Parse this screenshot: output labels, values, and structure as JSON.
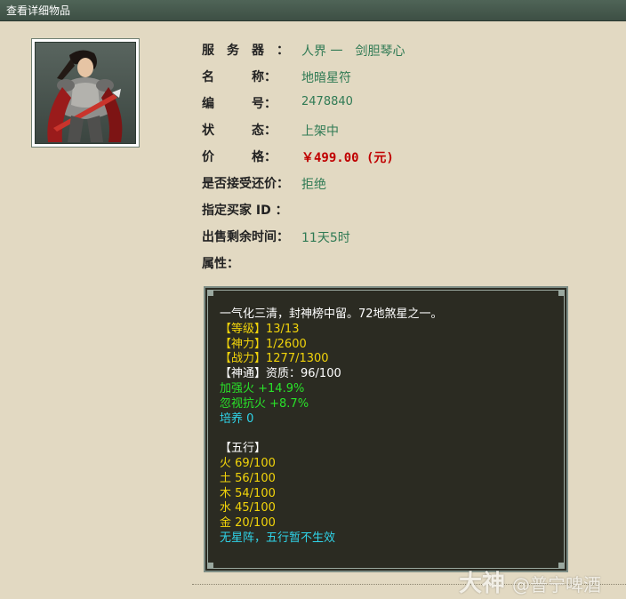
{
  "window": {
    "title": "查看详细物品"
  },
  "item": {
    "image_alt": "武将角色立绘",
    "fields": [
      {
        "label": "服　务　器　：",
        "value": "人界 一　剑胆琴心"
      },
      {
        "label": "名　　　称：",
        "value": "地暗星符"
      },
      {
        "label": "编　　　号：",
        "value": "2478840"
      },
      {
        "label": "状　　　态：",
        "value": "上架中"
      },
      {
        "label": "价　　　格：",
        "value": "￥499.00 (元)"
      },
      {
        "label": "是否接受还价：",
        "value": "拒绝"
      },
      {
        "label": "指定买家 ID ：",
        "value": ""
      },
      {
        "label": "出售剩余时间：",
        "value": "11天5时"
      },
      {
        "label": "属性：",
        "value": ""
      }
    ]
  },
  "attributes": {
    "lines": [
      {
        "text": "一气化三清，封神榜中留。72地煞星之一。",
        "color": "white"
      },
      {
        "text": "【等级】13/13",
        "color": "yellow"
      },
      {
        "text": "【神力】1/2600",
        "color": "yellow"
      },
      {
        "text": "【战力】1277/1300",
        "color": "yellow"
      },
      {
        "text": "【神通】资质：96/100",
        "color": "white"
      },
      {
        "text": "加强火 +14.9%",
        "color": "green"
      },
      {
        "text": "忽视抗火 +8.7%",
        "color": "green"
      },
      {
        "text": "培养 0",
        "color": "cyan"
      },
      {
        "text": "",
        "color": "white"
      },
      {
        "text": "【五行】",
        "color": "white"
      },
      {
        "text": "火 69/100",
        "color": "yellow"
      },
      {
        "text": "土 56/100",
        "color": "yellow"
      },
      {
        "text": "木 54/100",
        "color": "yellow"
      },
      {
        "text": "水 45/100",
        "color": "yellow"
      },
      {
        "text": "金 20/100",
        "color": "yellow"
      },
      {
        "text": "无星阵，五行暂不生效",
        "color": "cyan"
      }
    ]
  },
  "watermark": {
    "brand": "大神",
    "handle": "@普宁啤酒"
  },
  "colors": {
    "background": "#e2d9c2",
    "titlebar": "#46594d",
    "value_green": "#2f7a54",
    "price_red": "#c00000",
    "panel_bg": "#2b2b22"
  }
}
